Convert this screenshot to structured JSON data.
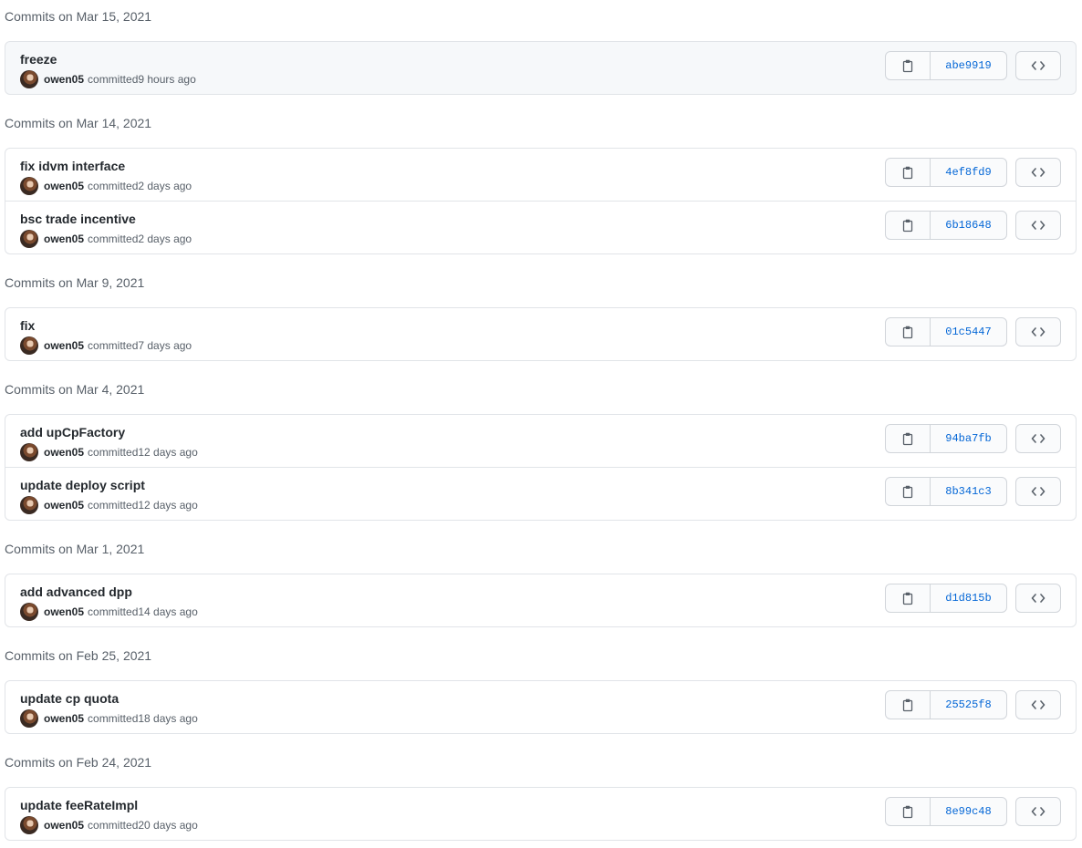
{
  "groups": [
    {
      "title": "Commits on Mar 15, 2021",
      "highlight": true,
      "commits": [
        {
          "message": "freeze",
          "author": "owen05",
          "verb": "committed",
          "time": "9 hours ago",
          "sha": "abe9919"
        }
      ]
    },
    {
      "title": "Commits on Mar 14, 2021",
      "highlight": false,
      "commits": [
        {
          "message": "fix idvm interface",
          "author": "owen05",
          "verb": "committed",
          "time": "2 days ago",
          "sha": "4ef8fd9"
        },
        {
          "message": "bsc trade incentive",
          "author": "owen05",
          "verb": "committed",
          "time": "2 days ago",
          "sha": "6b18648"
        }
      ]
    },
    {
      "title": "Commits on Mar 9, 2021",
      "highlight": false,
      "commits": [
        {
          "message": "fix",
          "author": "owen05",
          "verb": "committed",
          "time": "7 days ago",
          "sha": "01c5447"
        }
      ]
    },
    {
      "title": "Commits on Mar 4, 2021",
      "highlight": false,
      "commits": [
        {
          "message": "add upCpFactory",
          "author": "owen05",
          "verb": "committed",
          "time": "12 days ago",
          "sha": "94ba7fb"
        },
        {
          "message": "update deploy script",
          "author": "owen05",
          "verb": "committed",
          "time": "12 days ago",
          "sha": "8b341c3"
        }
      ]
    },
    {
      "title": "Commits on Mar 1, 2021",
      "highlight": false,
      "commits": [
        {
          "message": "add advanced dpp",
          "author": "owen05",
          "verb": "committed",
          "time": "14 days ago",
          "sha": "d1d815b"
        }
      ]
    },
    {
      "title": "Commits on Feb 25, 2021",
      "highlight": false,
      "commits": [
        {
          "message": "update cp quota",
          "author": "owen05",
          "verb": "committed",
          "time": "18 days ago",
          "sha": "25525f8"
        }
      ]
    },
    {
      "title": "Commits on Feb 24, 2021",
      "highlight": false,
      "commits": [
        {
          "message": "update feeRateImpl",
          "author": "owen05",
          "verb": "committed",
          "time": "20 days ago",
          "sha": "8e99c48"
        }
      ]
    }
  ],
  "icons": {
    "copy": "clipboard-icon",
    "browse": "code-icon"
  },
  "colors": {
    "sha_link": "#0366d6",
    "border": "#e1e4e8",
    "highlight_bg": "#f6f8fa",
    "muted_text": "#586069"
  }
}
